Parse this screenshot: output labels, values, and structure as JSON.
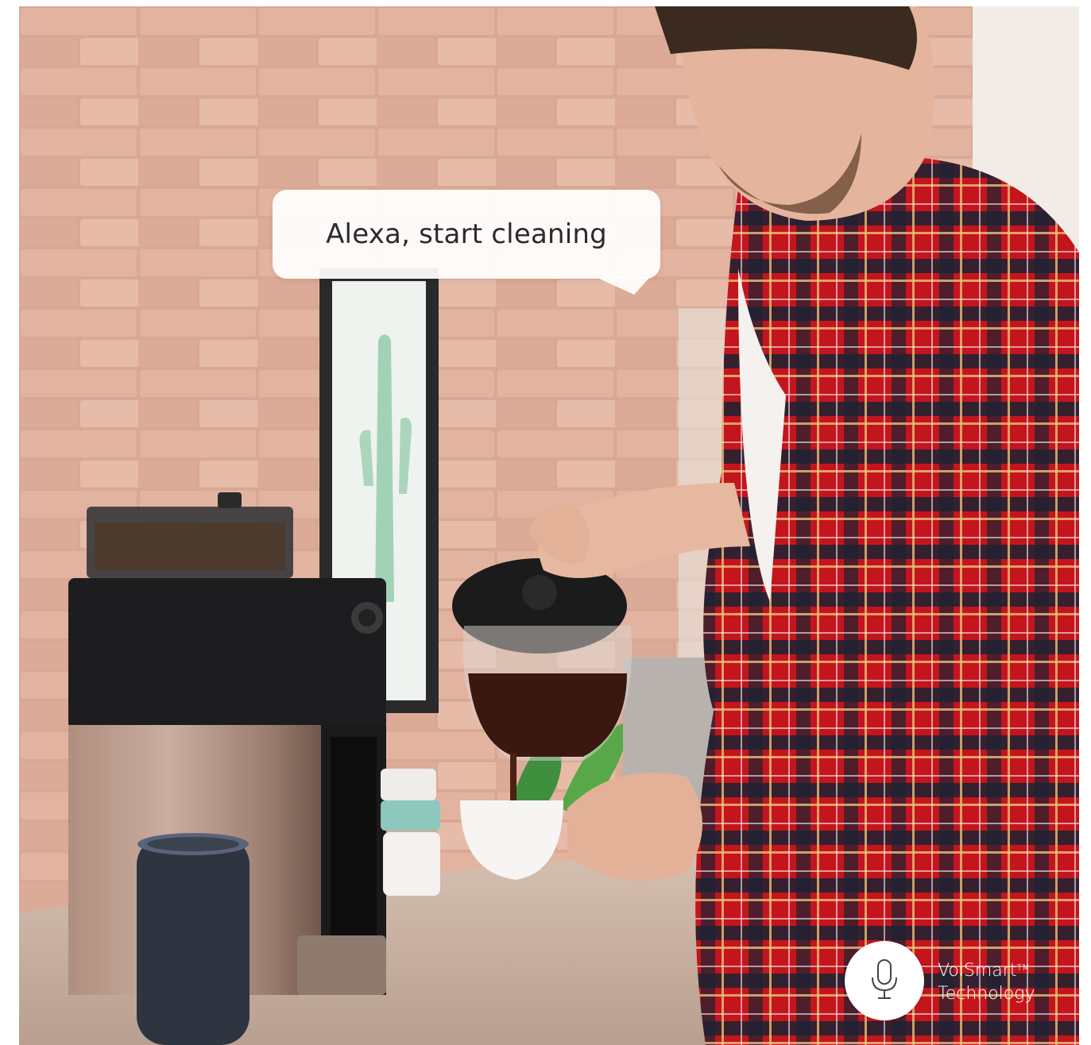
{
  "speech_bubble": {
    "text": "Alexa, start cleaning"
  },
  "badge": {
    "icon": "microphone-icon",
    "name": "VoiSmart",
    "trademark": "TM",
    "subtitle": "Technology"
  },
  "colors": {
    "brick_wall": "#d9a894",
    "shirt_red": "#c4151c",
    "shirt_navy": "#1c2233",
    "badge_bg": "#ffffff",
    "bubble_bg": "#ffffff",
    "text_dark": "#2b2b2b"
  }
}
